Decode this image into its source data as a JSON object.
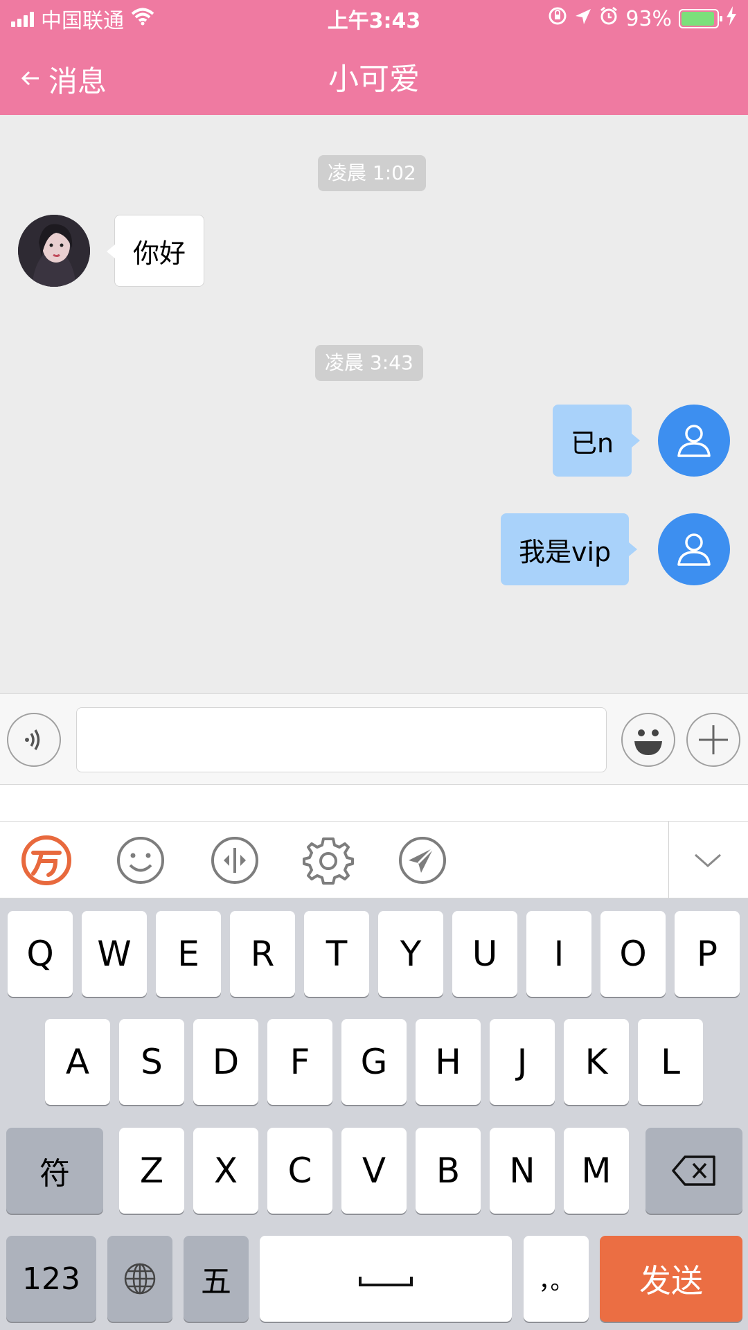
{
  "status_bar": {
    "carrier": "中国联通",
    "time": "上午3:43",
    "battery_percent": "93%",
    "battery_level": 0.93,
    "icons": [
      "signal-icon",
      "wifi-icon",
      "orientation-lock-icon",
      "location-icon",
      "alarm-icon",
      "battery-icon",
      "charging-icon"
    ]
  },
  "header": {
    "back_label": "消息",
    "title": "小可爱"
  },
  "messages": [
    {
      "type": "timestamp",
      "text": "凌晨 1:02"
    },
    {
      "type": "received",
      "text": "你好"
    },
    {
      "type": "timestamp",
      "text": "凌晨 3:43"
    },
    {
      "type": "sent",
      "text": "已n"
    },
    {
      "type": "sent",
      "text": "我是vip"
    }
  ],
  "input_bar": {
    "value": "",
    "placeholder": ""
  },
  "ime_toolbar": {
    "icons": [
      "ime-logo-icon",
      "emoji-icon",
      "cursor-move-icon",
      "settings-icon",
      "share-icon",
      "chevron-down-icon"
    ]
  },
  "keyboard": {
    "row1": [
      "Q",
      "W",
      "E",
      "R",
      "T",
      "Y",
      "U",
      "I",
      "O",
      "P"
    ],
    "row2": [
      "A",
      "S",
      "D",
      "F",
      "G",
      "H",
      "J",
      "K",
      "L"
    ],
    "row3": [
      "Z",
      "X",
      "C",
      "V",
      "B",
      "N",
      "M"
    ],
    "symbol_key": "符",
    "numbers_key": "123",
    "five_key": "五",
    "punct_key": "，。",
    "send_key": "发送"
  },
  "colors": {
    "header": "#ef7aa1",
    "sent_bubble": "#a9d2fa",
    "user_avatar": "#3d8ff0",
    "send_key": "#eb6e43"
  }
}
